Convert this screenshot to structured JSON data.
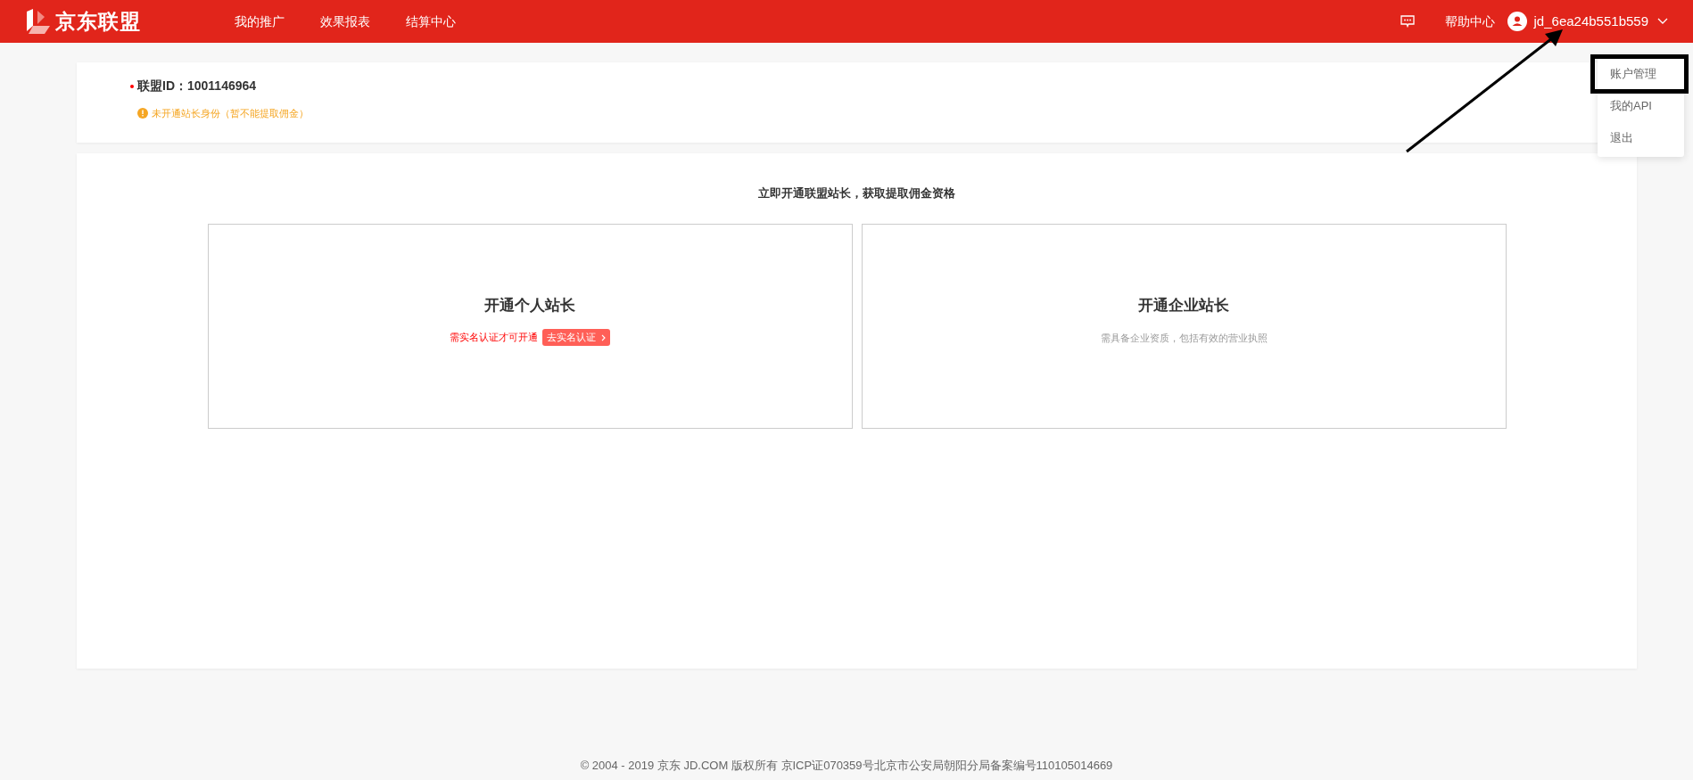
{
  "header": {
    "logo": "京东联盟",
    "nav": [
      {
        "label": "我的推广"
      },
      {
        "label": "效果报表"
      },
      {
        "label": "结算中心"
      }
    ],
    "help": "帮助中心",
    "username": "jd_6ea24b551b559"
  },
  "user_menu": {
    "items": [
      {
        "label": "账户管理",
        "highlighted": true
      },
      {
        "label": "我的API",
        "highlighted": false
      },
      {
        "label": "退出",
        "highlighted": false
      }
    ]
  },
  "account": {
    "id_label": "联盟ID：",
    "id_value": "1001146964",
    "warning": "未开通站长身份（暂不能提取佣金）"
  },
  "open": {
    "title": "立即开通联盟站长，获取提取佣金资格",
    "options": [
      {
        "kind": "personal",
        "title": "开通个人站长",
        "note": "需实名认证才可开通",
        "button": "去实名认证"
      },
      {
        "kind": "company",
        "title": "开通企业站长",
        "note": "需具备企业资质，包括有效的营业执照"
      }
    ]
  },
  "footer": "© 2004 - 2019 京东 JD.COM 版权所有 京ICP证070359号北京市公安局朝阳分局备案编号110105014669"
}
